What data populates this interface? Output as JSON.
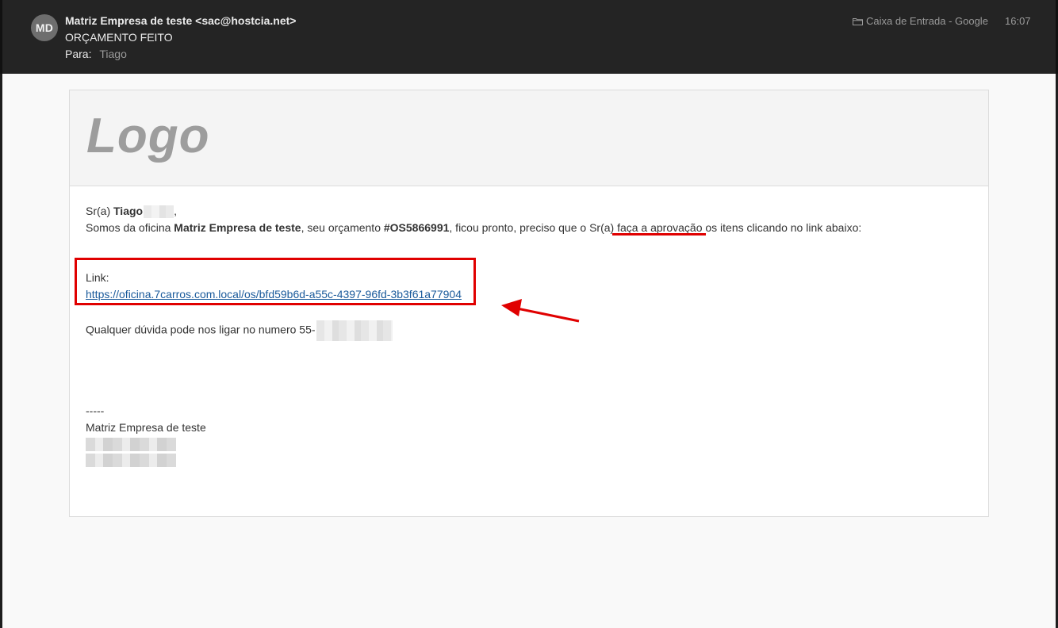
{
  "header": {
    "avatar_initials": "MD",
    "from": "Matriz Empresa de teste <sac@hostcia.net>",
    "subject": "ORÇAMENTO FEITO",
    "to_label": "Para:",
    "to_name": "Tiago",
    "mailbox": "Caixa de Entrada - Google",
    "time": "16:07",
    "mailbox_icon": "folder-icon"
  },
  "email": {
    "logo": "Logo",
    "greeting_prefix": "Sr(a) ",
    "greeting_name": "Tiago",
    "greeting_suffix": ",",
    "intro_1": "Somos da oficina ",
    "intro_company": "Matriz Empresa de teste",
    "intro_2": ", seu orçamento ",
    "intro_os": "#OS5866991",
    "intro_3": ", ficou pronto, preciso que o Sr(a) faça a aprovação os itens clicando no link abaixo:",
    "link_label": "Link:",
    "link_url": "https://oficina.7carros.com.local/os/bfd59b6d-a55c-4397-96fd-3b3f61a77904",
    "contact": "Qualquer dúvida pode nos ligar no numero 55-",
    "signature_separator": "-----",
    "signature_name": "Matriz Empresa de teste"
  },
  "colors": {
    "annotation": "#e00000",
    "link": "#1a5a9b",
    "header_bg": "#242424"
  }
}
